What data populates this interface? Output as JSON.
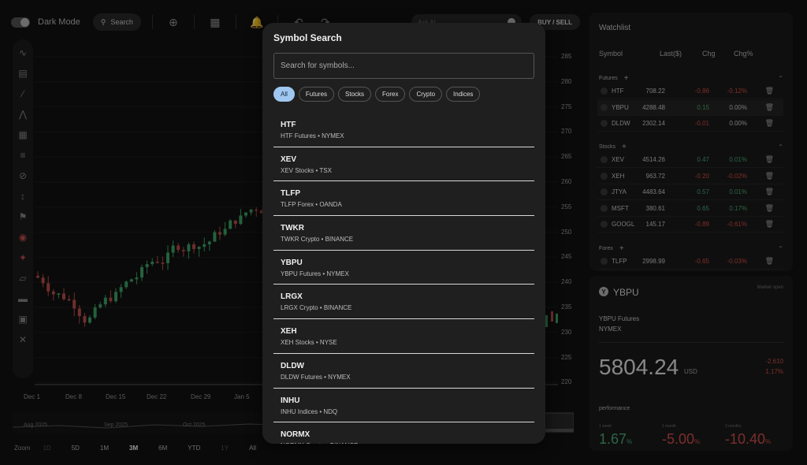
{
  "toolbar": {
    "dark_mode_label": "Dark Mode",
    "search_label": "Search",
    "ask_ai_placeholder": "Ask AI...",
    "buy_sell_label": "BUY / SELL"
  },
  "chart": {
    "x_labels": [
      "Dec 1",
      "Dec 8",
      "Dec 15",
      "Dec 22",
      "Dec 29",
      "Jan 5"
    ],
    "price_labels": [
      "285",
      "280",
      "275",
      "270",
      "265",
      "260",
      "255",
      "250",
      "245",
      "240",
      "235",
      "230",
      "225",
      "220"
    ],
    "minimap_labels": [
      "Aug 2025",
      "Sep 2025",
      "Oct 2025"
    ],
    "zoom_label": "Zoom",
    "zoom_options": [
      {
        "label": "1D",
        "state": "dim"
      },
      {
        "label": "5D",
        "state": "normal"
      },
      {
        "label": "1M",
        "state": "normal"
      },
      {
        "label": "3M",
        "state": "active"
      },
      {
        "label": "6M",
        "state": "normal"
      },
      {
        "label": "YTD",
        "state": "normal"
      },
      {
        "label": "1Y",
        "state": "dim"
      },
      {
        "label": "All",
        "state": "normal"
      }
    ],
    "up_color": "#3fa86a",
    "down_color": "#c0504d"
  },
  "watchlist": {
    "title": "Watchlist",
    "columns": [
      "Symbol",
      "Last($)",
      "Chg",
      "Chg%"
    ],
    "groups": [
      {
        "name": "Futures",
        "rows": [
          {
            "symbol": "HTF",
            "last": "708.22",
            "chg": "-0.86",
            "chgp": "-0.12%",
            "dir": "neg",
            "selected": false
          },
          {
            "symbol": "YBPU",
            "last": "4288.48",
            "chg": "0.15",
            "chgp": "0.00%",
            "dir": "mixed",
            "selected": true
          },
          {
            "symbol": "DLDW",
            "last": "2302.14",
            "chg": "-0.01",
            "chgp": "0.00%",
            "dir": "mixedneg",
            "selected": false
          }
        ]
      },
      {
        "name": "Stocks",
        "rows": [
          {
            "symbol": "XEV",
            "last": "4514.26",
            "chg": "0.47",
            "chgp": "0.01%",
            "dir": "pos",
            "selected": false
          },
          {
            "symbol": "XEH",
            "last": "963.72",
            "chg": "-0.20",
            "chgp": "-0.02%",
            "dir": "neg",
            "selected": false
          },
          {
            "symbol": "JTYA",
            "last": "4483.64",
            "chg": "0.57",
            "chgp": "0.01%",
            "dir": "pos",
            "selected": false
          },
          {
            "symbol": "MSFT",
            "last": "380.61",
            "chg": "0.65",
            "chgp": "0.17%",
            "dir": "pos",
            "selected": false
          },
          {
            "symbol": "GOOGL",
            "last": "145.17",
            "chg": "-0.89",
            "chgp": "-0.61%",
            "dir": "neg",
            "selected": false
          }
        ]
      },
      {
        "name": "Forex",
        "rows": [
          {
            "symbol": "TLFP",
            "last": "2998.99",
            "chg": "-0.65",
            "chgp": "-0.03%",
            "dir": "neg",
            "selected": false
          }
        ]
      }
    ]
  },
  "details": {
    "logo": "Y",
    "symbol": "YBPU",
    "status": "Market open",
    "name": "YBPU Futures",
    "exchange": "NYMEX",
    "price": "5804.24",
    "currency": "USD",
    "change": "-2.610",
    "change_pct": "1.17%",
    "performance_label": "performance",
    "performance": [
      {
        "label": "1 week",
        "value": "1.67",
        "unit": "%",
        "dir": "pos"
      },
      {
        "label": "1 month",
        "value": "-5.00",
        "unit": "%",
        "dir": "neg"
      },
      {
        "label": "3 months",
        "value": "-10.40",
        "unit": "%",
        "dir": "neg"
      }
    ]
  },
  "modal": {
    "title": "Symbol Search",
    "placeholder": "Search for symbols...",
    "filters": [
      {
        "label": "All",
        "active": true
      },
      {
        "label": "Futures",
        "active": false
      },
      {
        "label": "Stocks",
        "active": false
      },
      {
        "label": "Forex",
        "active": false
      },
      {
        "label": "Crypto",
        "active": false
      },
      {
        "label": "Indices",
        "active": false
      }
    ],
    "results": [
      {
        "symbol": "HTF",
        "subtitle": "HTF Futures • NYMEX"
      },
      {
        "symbol": "XEV",
        "subtitle": "XEV Stocks • TSX"
      },
      {
        "symbol": "TLFP",
        "subtitle": "TLFP Forex • OANDA"
      },
      {
        "symbol": "TWKR",
        "subtitle": "TWKR Crypto • BINANCE"
      },
      {
        "symbol": "YBPU",
        "subtitle": "YBPU Futures • NYMEX"
      },
      {
        "symbol": "LRGX",
        "subtitle": "LRGX Crypto • BINANCE"
      },
      {
        "symbol": "XEH",
        "subtitle": "XEH Stocks • NYSE"
      },
      {
        "symbol": "DLDW",
        "subtitle": "DLDW Futures • NYMEX"
      },
      {
        "symbol": "INHU",
        "subtitle": "INHU Indices • NDQ"
      },
      {
        "symbol": "NORMX",
        "subtitle": "NORMX Crypto • BINANCE"
      }
    ]
  }
}
